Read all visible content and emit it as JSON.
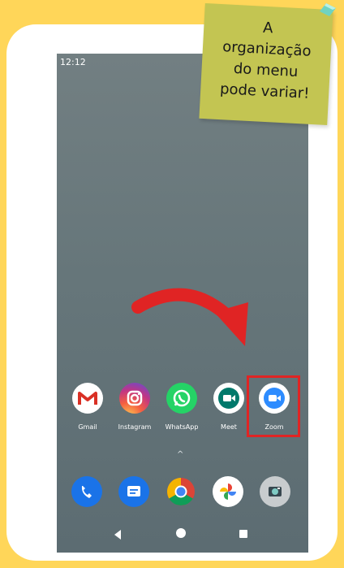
{
  "colors": {
    "background": "#FFD659",
    "card": "#FFFFFF",
    "sticky": "#C3C552",
    "highlight": "#E02424",
    "arrow": "#E02424"
  },
  "status_bar": {
    "time": "12:12"
  },
  "sticky_note": {
    "lines": [
      "A",
      "organização",
      "do menu",
      "pode variar!"
    ]
  },
  "apps": [
    {
      "label": "Gmail",
      "icon": "gmail-icon"
    },
    {
      "label": "Instagram",
      "icon": "instagram-icon"
    },
    {
      "label": "WhatsApp",
      "icon": "whatsapp-icon"
    },
    {
      "label": "Meet",
      "icon": "meet-icon"
    },
    {
      "label": "Zoom",
      "icon": "zoom-icon"
    }
  ],
  "dock": [
    {
      "icon": "phone-icon"
    },
    {
      "icon": "messages-icon"
    },
    {
      "icon": "chrome-icon"
    },
    {
      "icon": "photos-icon"
    },
    {
      "icon": "camera-icon"
    }
  ],
  "navigation": [
    "back-button",
    "home-button",
    "recents-button"
  ]
}
